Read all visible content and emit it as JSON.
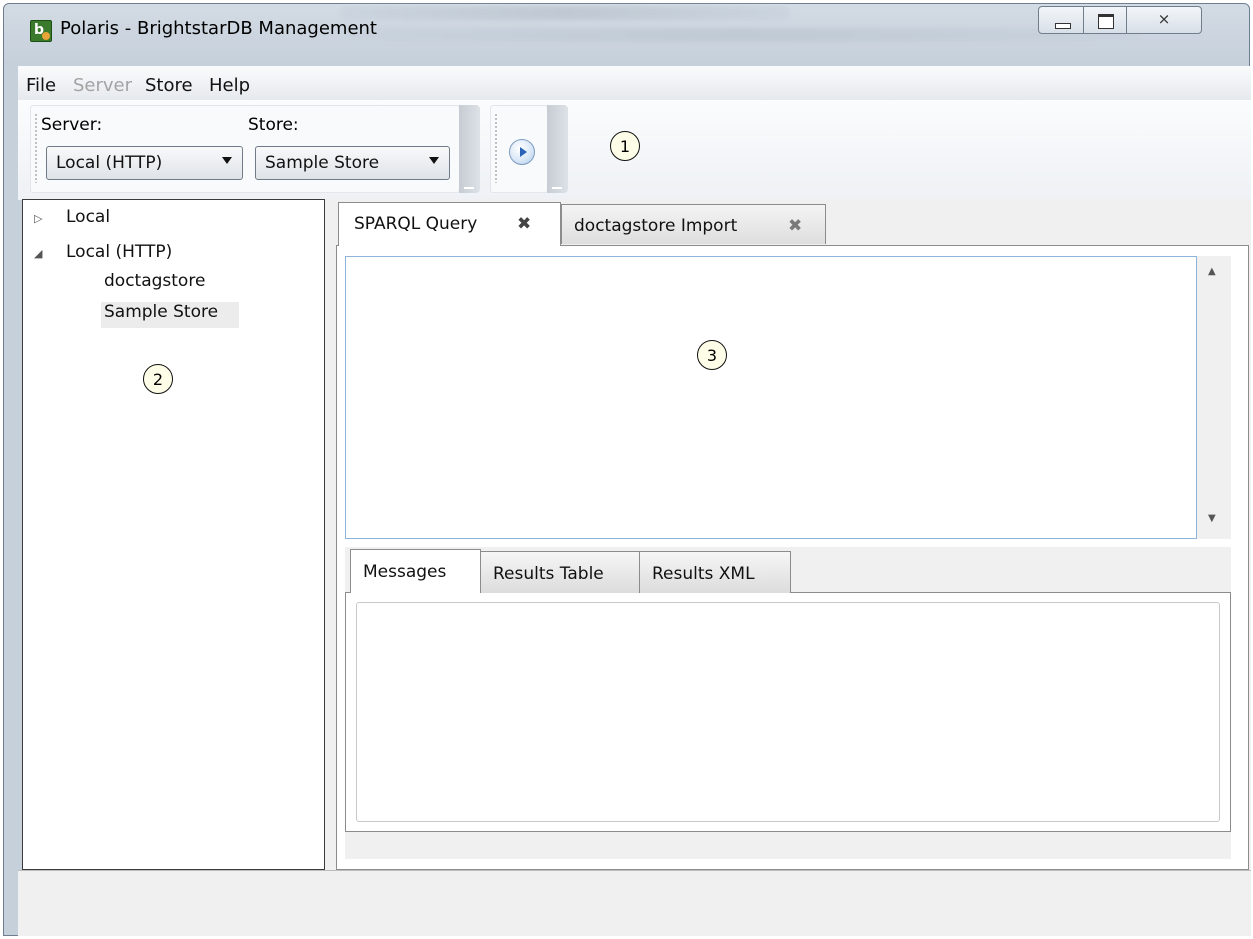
{
  "window": {
    "title": "Polaris - BrightstarDB Management",
    "close_glyph": "⨯"
  },
  "menu": {
    "items": [
      {
        "label": "File",
        "enabled": true
      },
      {
        "label": "Server",
        "enabled": false
      },
      {
        "label": "Store",
        "enabled": true
      },
      {
        "label": "Help",
        "enabled": true
      }
    ]
  },
  "toolbar": {
    "server_label": "Server:",
    "server_value": "Local (HTTP)",
    "store_label": "Store:",
    "store_value": "Sample Store",
    "run_icon": "play-circle-icon"
  },
  "callouts": [
    "1",
    "2",
    "3"
  ],
  "tree": {
    "nodes": [
      {
        "label": "Local",
        "expander": "▷"
      },
      {
        "label": "Local (HTTP)",
        "expander": "◢"
      },
      {
        "label": "doctagstore"
      },
      {
        "label": "Sample Store",
        "selected": true
      }
    ]
  },
  "tabs": [
    {
      "label": "SPARQL Query",
      "close": "✖",
      "active": true
    },
    {
      "label": "doctagstore Import",
      "close": "✖",
      "active": false
    }
  ],
  "editor": {
    "value": "",
    "scroll_up": "▲",
    "scroll_down": "▼"
  },
  "output_tabs": [
    {
      "label": "Messages",
      "active": true
    },
    {
      "label": "Results Table",
      "active": false
    },
    {
      "label": "Results XML",
      "active": false
    }
  ],
  "messages": {
    "value": ""
  },
  "colors": {
    "frame": "#c6d0db",
    "selection": "#ececec",
    "editor_border": "#8fb4da"
  }
}
